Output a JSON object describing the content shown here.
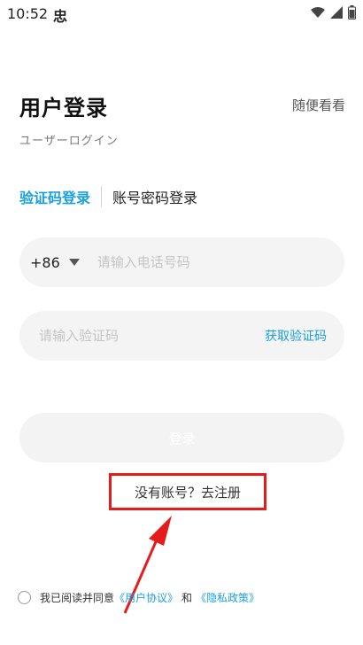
{
  "status_bar": {
    "time": "10:52",
    "app_icon": "忠"
  },
  "header": {
    "title": "用户登录",
    "browse_label": "随便看看",
    "subtitle": "ユーザーログイン"
  },
  "tabs": {
    "active_label": "验证码登录",
    "inactive_label": "账号密码登录"
  },
  "phone": {
    "country_code": "+86",
    "placeholder": "请输入电话号码",
    "value": ""
  },
  "verification": {
    "placeholder": "请输入验证码",
    "value": "",
    "get_code_label": "获取验证码"
  },
  "login_button_label": "登录",
  "register_label": "没有账号？去注册",
  "agreement": {
    "prefix": "我已阅读并同意",
    "user_agreement": "《用户协议》",
    "and": "和",
    "privacy_policy": "《隐私政策》"
  },
  "colors": {
    "accent": "#1a9fe0",
    "annotation_red": "#e51c1c"
  },
  "icons": [
    "wifi-icon",
    "signal-icon",
    "battery-icon",
    "dropdown-caret-icon",
    "checkbox-icon"
  ]
}
